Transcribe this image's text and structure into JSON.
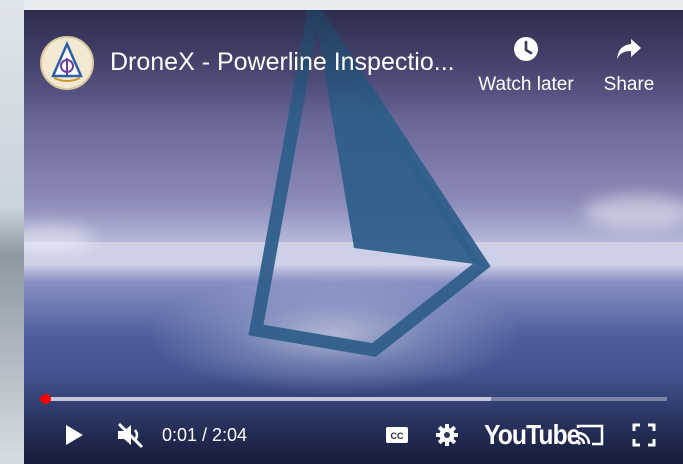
{
  "video": {
    "title": "DroneX - Powerline Inspectio...",
    "channel_avatar_icon": "channel-logo-icon"
  },
  "top_actions": {
    "watch_later_label": "Watch later",
    "watch_later_icon": "clock-icon",
    "share_label": "Share",
    "share_icon": "share-arrow-icon"
  },
  "progress": {
    "played_fraction": 0.008,
    "buffered_fraction": 0.72,
    "played_color": "#ff0000"
  },
  "controls": {
    "play_icon": "play-icon",
    "mute_icon": "muted-speaker-icon",
    "time_display": "0:01 / 2:04",
    "captions_icon": "cc-icon",
    "settings_icon": "gear-icon",
    "youtube_logo": "YouTube",
    "cast_icon": "cast-icon",
    "fullscreen_icon": "fullscreen-icon"
  }
}
